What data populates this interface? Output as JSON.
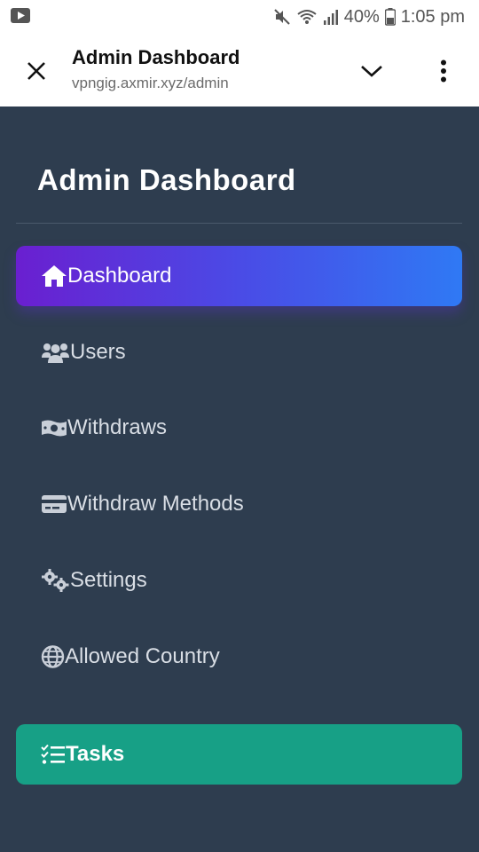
{
  "status_bar": {
    "battery": "40%",
    "time": "1:05 pm",
    "icons": [
      "youtube-icon",
      "mute-icon",
      "wifi-icon",
      "signal-icon",
      "battery-icon"
    ]
  },
  "browser": {
    "title": "Admin Dashboard",
    "url": "vpngig.axmir.xyz/admin",
    "icons": [
      "close-icon",
      "chevron-down-icon",
      "more-vertical-icon"
    ]
  },
  "sidebar": {
    "title": "Admin Dashboard",
    "items": [
      {
        "label": "Dashboard",
        "icon": "home-icon",
        "active": true
      },
      {
        "label": "Users",
        "icon": "users-icon"
      },
      {
        "label": "Withdraws",
        "icon": "money-icon"
      },
      {
        "label": "Withdraw Methods",
        "icon": "credit-card-icon"
      },
      {
        "label": "Settings",
        "icon": "gears-icon"
      },
      {
        "label": "Allowed Country",
        "icon": "globe-icon"
      },
      {
        "label": "Tasks",
        "icon": "tasks-icon",
        "highlight": "#17a086"
      }
    ],
    "colors": {
      "background": "#2e3d4f",
      "active_gradient_start": "#6a1fd0",
      "active_gradient_end": "#2f79f4",
      "tasks_bg": "#17a086"
    }
  }
}
